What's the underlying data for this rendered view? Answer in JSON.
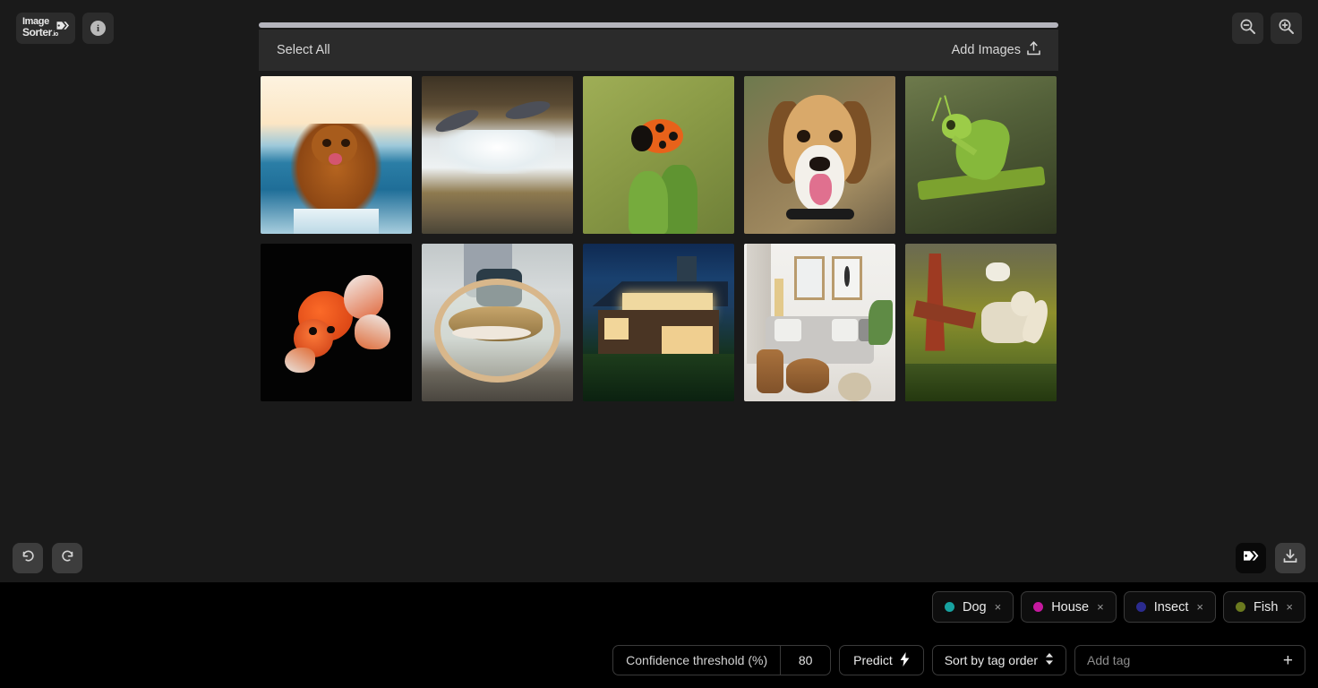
{
  "brand": {
    "name_line1": "Image",
    "name_line2": "Sorter",
    "domain": ".io",
    "logo_icon": "tag-icon",
    "info_icon": "info-icon",
    "info_label": "i"
  },
  "zoom_controls": {
    "zoom_out_icon": "magnifier-minus-icon",
    "zoom_in_icon": "magnifier-plus-icon"
  },
  "panel": {
    "select_all_label": "Select All",
    "add_images_label": "Add Images",
    "add_images_icon": "upload-icon",
    "scrollbar": "horizontal-scrollbar"
  },
  "images": [
    {
      "name": "golden-retriever-running-in-ocean-surf",
      "subject": "dog"
    },
    {
      "name": "salmon-leaping-up-river-rapids",
      "subject": "fish"
    },
    {
      "name": "ladybug-on-green-plant-bud",
      "subject": "insect"
    },
    {
      "name": "beagle-portrait-with-tongue-out",
      "subject": "dog"
    },
    {
      "name": "praying-mantis-on-stem",
      "subject": "insect"
    },
    {
      "name": "orange-goldfish-on-black-background",
      "subject": "fish"
    },
    {
      "name": "trout-in-landing-net",
      "subject": "fish"
    },
    {
      "name": "modern-house-at-dusk-with-lit-windows",
      "subject": "house"
    },
    {
      "name": "living-room-interior-with-grey-sofa",
      "subject": "house"
    },
    {
      "name": "white-dog-in-overgrown-garden",
      "subject": "dog"
    }
  ],
  "history": {
    "undo_icon": "undo-icon",
    "redo_icon": "redo-icon"
  },
  "actions": {
    "tags_icon": "tags-icon",
    "download_icon": "download-icon"
  },
  "tags": [
    {
      "label": "Dog",
      "color": "#17a2a0",
      "remove_icon": "close-icon",
      "remove_label": "×"
    },
    {
      "label": "House",
      "color": "#c5199f",
      "remove_icon": "close-icon",
      "remove_label": "×"
    },
    {
      "label": "Insect",
      "color": "#2b2b8f",
      "remove_icon": "close-icon",
      "remove_label": "×"
    },
    {
      "label": "Fish",
      "color": "#6b7a1f",
      "remove_icon": "close-icon",
      "remove_label": "×"
    }
  ],
  "controls": {
    "confidence_label": "Confidence threshold (%)",
    "confidence_value": "80",
    "predict_label": "Predict",
    "predict_icon": "lightning-bolt-icon",
    "sort_label": "Sort by tag order",
    "sort_icon": "chevron-updown-icon",
    "add_tag_placeholder": "Add tag",
    "add_tag_value": "",
    "add_tag_icon": "plus-icon"
  }
}
